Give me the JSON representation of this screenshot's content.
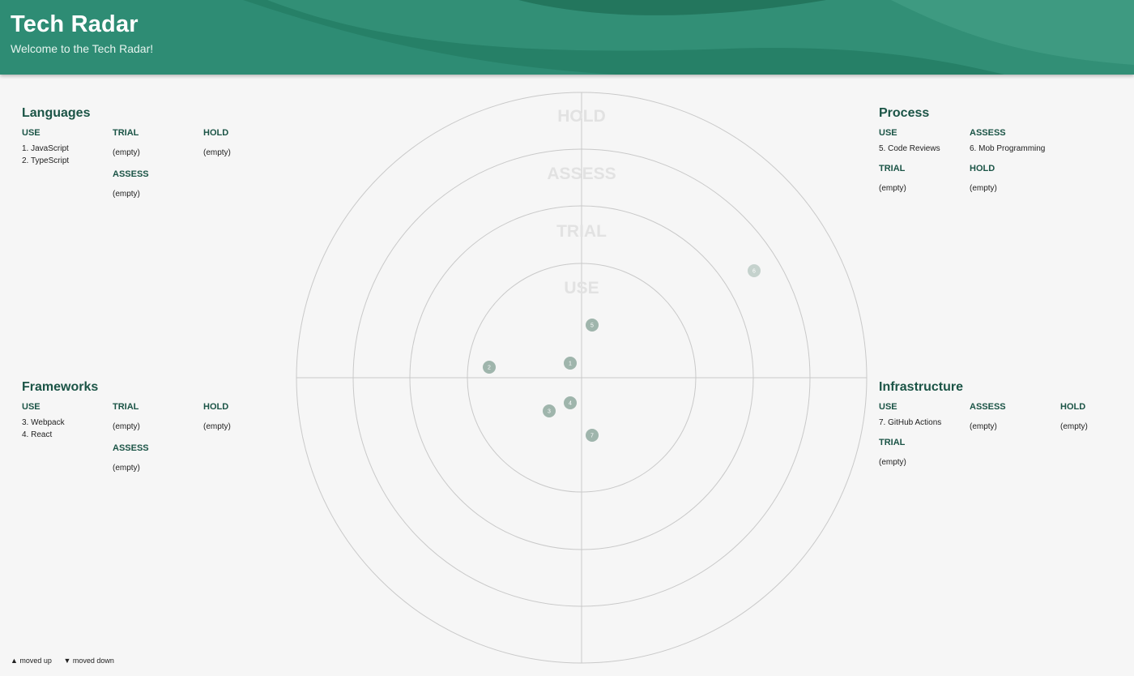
{
  "header": {
    "title": "Tech Radar",
    "subtitle": "Welcome to the Tech Radar!"
  },
  "rings": {
    "use": "USE",
    "trial": "TRIAL",
    "assess": "ASSESS",
    "hold": "HOLD"
  },
  "quadrants": {
    "languages": {
      "title": "Languages",
      "use": [
        "1. JavaScript",
        "2. TypeScript"
      ],
      "trial": "(empty)",
      "assess": "(empty)",
      "hold": "(empty)"
    },
    "process": {
      "title": "Process",
      "use": [
        "5. Code Reviews"
      ],
      "assess": [
        "6. Mob Programming"
      ],
      "trial": "(empty)",
      "hold": "(empty)"
    },
    "frameworks": {
      "title": "Frameworks",
      "use": [
        "3. Webpack",
        "4. React"
      ],
      "trial": "(empty)",
      "assess": "(empty)",
      "hold": "(empty)"
    },
    "infrastructure": {
      "title": "Infrastructure",
      "use": [
        "7. GitHub Actions"
      ],
      "assess": "(empty)",
      "hold": "(empty)",
      "trial": "(empty)"
    }
  },
  "blips": [
    "1",
    "2",
    "3",
    "4",
    "5",
    "6",
    "7"
  ],
  "legend": {
    "moved_up": "▲ moved up",
    "moved_down": "▼ moved down"
  },
  "colors": {
    "header": "#2e8c74",
    "heading": "#1b5446",
    "blip": "#9fb5ac",
    "grid": "#c9c9c9",
    "ring_label": "#e2e2e2"
  }
}
